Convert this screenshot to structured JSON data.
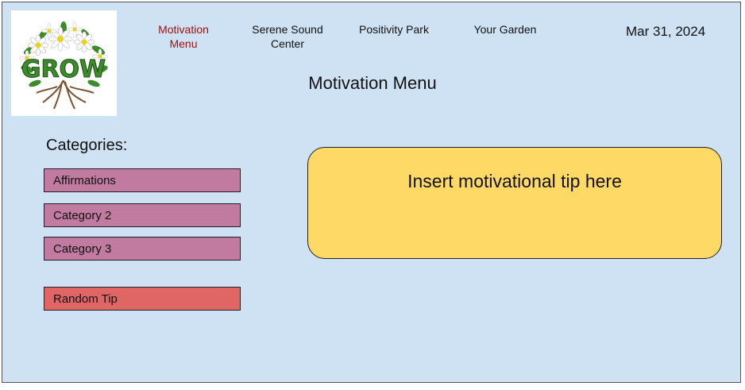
{
  "app": {
    "logo_alt": "GROW"
  },
  "nav": {
    "items": [
      {
        "label": "Motivation\nMenu",
        "active": true
      },
      {
        "label": "Serene Sound\nCenter",
        "active": false
      },
      {
        "label": "Positivity Park",
        "active": false
      },
      {
        "label": "Your Garden",
        "active": false
      }
    ]
  },
  "header": {
    "date": "Mar 31, 2024",
    "title": "Motivation Menu"
  },
  "sidebar": {
    "heading": "Categories:",
    "categories": [
      {
        "label": "Affirmations"
      },
      {
        "label": "Category 2"
      },
      {
        "label": "Category 3"
      }
    ],
    "random_label": "Random Tip"
  },
  "tip": {
    "text": "Insert motivational tip here"
  },
  "colors": {
    "background": "#cfe2f3",
    "category_button": "#c27ba0",
    "random_button": "#e06666",
    "tip_box": "#ffd966",
    "active_nav": "#a01010"
  }
}
